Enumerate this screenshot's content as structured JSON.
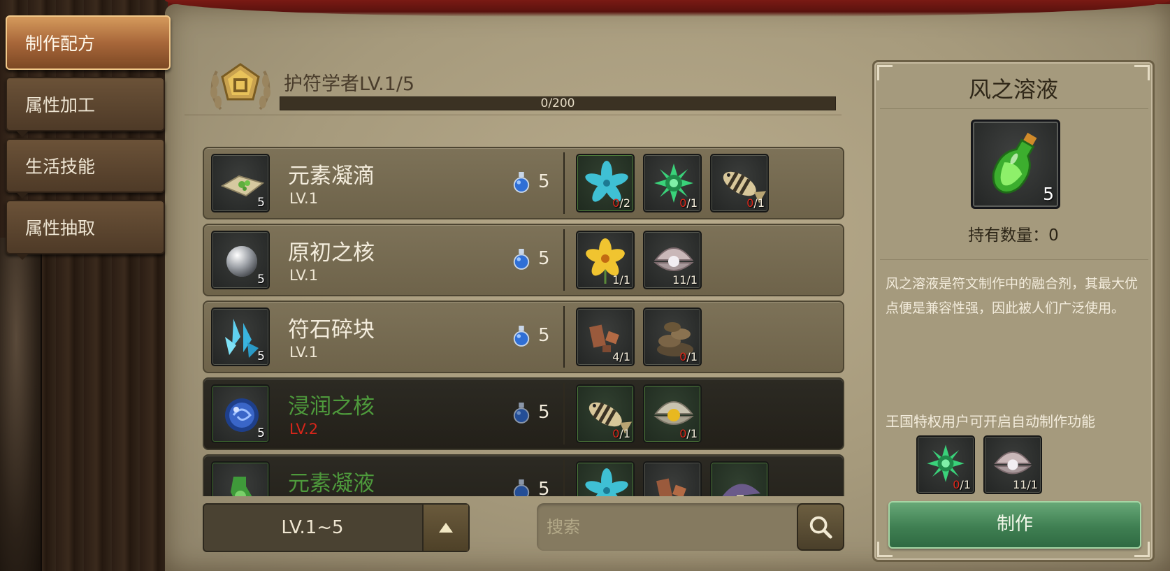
{
  "side_tabs": [
    {
      "label": "制作配方",
      "active": true
    },
    {
      "label": "属性加工",
      "active": false
    },
    {
      "label": "生活技能",
      "active": false
    },
    {
      "label": "属性抽取",
      "active": false
    }
  ],
  "header": {
    "title": "护符学者LV.1/5",
    "xp_text": "0/200",
    "xp_fraction": 0
  },
  "recipes": [
    {
      "name": "元素凝滴",
      "level": "LV.1",
      "count": "5",
      "cost": "5",
      "locked": false,
      "icon": "herb-pouch-icon",
      "materials": [
        {
          "icon": "blue-flower-icon",
          "have": "0",
          "need": "/2",
          "ok": true,
          "short": true
        },
        {
          "icon": "green-spore-icon",
          "have": "0",
          "need": "/1",
          "ok": false,
          "short": true
        },
        {
          "icon": "striped-fish-icon",
          "have": "0",
          "need": "/1",
          "ok": false,
          "short": true
        }
      ]
    },
    {
      "name": "原初之核",
      "level": "LV.1",
      "count": "5",
      "cost": "5",
      "locked": false,
      "icon": "silver-orb-icon",
      "materials": [
        {
          "icon": "yellow-flower-icon",
          "have": "1",
          "need": "/1",
          "ok": false,
          "short": false
        },
        {
          "icon": "pearl-shell-icon",
          "have": "11",
          "need": "/1",
          "ok": false,
          "short": false
        }
      ]
    },
    {
      "name": "符石碎块",
      "level": "LV.1",
      "count": "5",
      "cost": "5",
      "locked": false,
      "icon": "blue-crystal-icon",
      "materials": [
        {
          "icon": "copper-ore-icon",
          "have": "4",
          "need": "/1",
          "ok": false,
          "short": false
        },
        {
          "icon": "rock-pile-icon",
          "have": "0",
          "need": "/1",
          "ok": false,
          "short": true
        }
      ]
    },
    {
      "name": "浸润之核",
      "level": "LV.2",
      "count": "5",
      "cost": "5",
      "locked": true,
      "icon": "blue-swirl-orb-icon",
      "materials": [
        {
          "icon": "striped-fish-icon",
          "have": "0",
          "need": "/1",
          "ok": true,
          "short": true
        },
        {
          "icon": "gold-pearl-shell-icon",
          "have": "0",
          "need": "/1",
          "ok": true,
          "short": true
        }
      ]
    },
    {
      "name": "元素凝液",
      "level": "",
      "count": "",
      "cost": "5",
      "locked": true,
      "icon": "green-flask-icon",
      "materials": [
        {
          "icon": "blue-flower-icon",
          "have": "",
          "need": "",
          "ok": true,
          "short": false
        },
        {
          "icon": "copper-ore-icon",
          "have": "",
          "need": "",
          "ok": false,
          "short": false
        },
        {
          "icon": "purple-mushroom-icon",
          "have": "",
          "need": "",
          "ok": true,
          "short": false
        }
      ]
    }
  ],
  "level_filter": {
    "label": "LV.1~5"
  },
  "search": {
    "placeholder": "搜索"
  },
  "detail": {
    "title": "风之溶液",
    "icon": "green-potion-bottle-icon",
    "count": "5",
    "owned": "持有数量：0",
    "description": "风之溶液是符文制作中的融合剂，其最大优点便是兼容性强，因此被人们广泛使用。",
    "privilege_note": "王国特权用户可开启自动制作功能",
    "materials": [
      {
        "icon": "green-spore-icon",
        "have": "0",
        "need": "/1",
        "short": true
      },
      {
        "icon": "pearl-shell-icon",
        "have": "11",
        "need": "/1",
        "short": false
      }
    ],
    "make_label": "制作"
  },
  "colors": {
    "parchment": "#a69a7c",
    "locked_name": "#4e9a3c",
    "insufficient": "#e0281c",
    "make_button": "#3f7f52"
  }
}
